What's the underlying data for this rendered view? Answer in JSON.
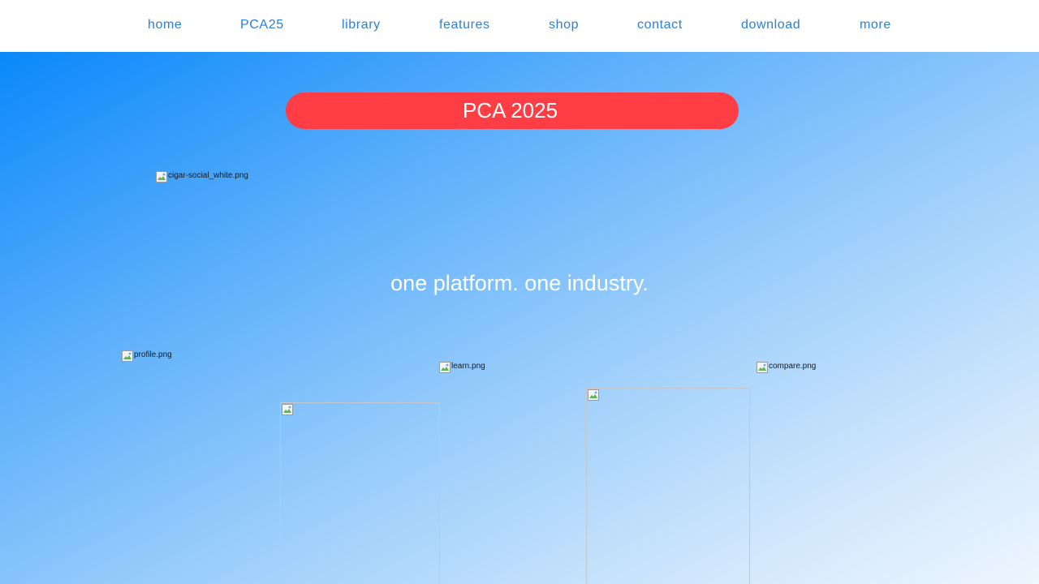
{
  "nav": {
    "items": [
      {
        "label": "home"
      },
      {
        "label": "PCA25"
      },
      {
        "label": "library"
      },
      {
        "label": "features"
      },
      {
        "label": "shop"
      },
      {
        "label": "contact"
      },
      {
        "label": "download"
      },
      {
        "label": "more"
      }
    ],
    "link_color": "#2b7fd6"
  },
  "hero": {
    "banner_text": "PCA 2025",
    "banner_color": "#ff3d44",
    "logo_alt": "cigar-social_white.png",
    "tagline": "one platform. one industry.",
    "gradient_start": "#0a88fb",
    "gradient_end": "#eef6fe"
  },
  "features": {
    "profile_alt": "profile.png",
    "learn_alt": "learn.png",
    "compare_alt": "compare.png"
  }
}
